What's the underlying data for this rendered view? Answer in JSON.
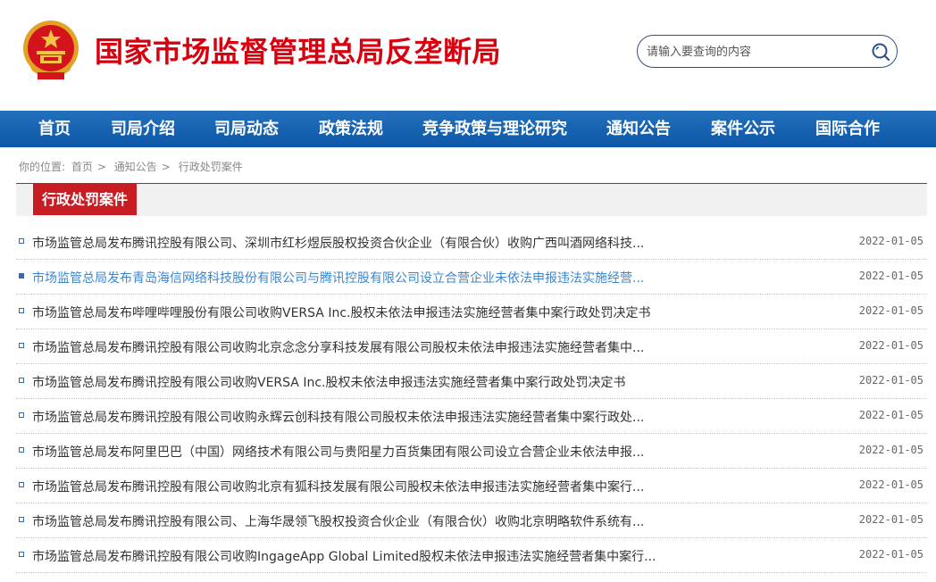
{
  "header": {
    "site_title": "国家市场监督管理总局反垄断局",
    "search_placeholder": "请输入要查询的内容"
  },
  "nav": {
    "items": [
      {
        "label": "首页"
      },
      {
        "label": "司局介绍"
      },
      {
        "label": "司局动态"
      },
      {
        "label": "政策法规"
      },
      {
        "label": "竞争政策与理论研究"
      },
      {
        "label": "通知公告"
      },
      {
        "label": "案件公示"
      },
      {
        "label": "国际合作"
      }
    ]
  },
  "breadcrumb": {
    "prefix": "你的位置:",
    "items": [
      "首页",
      "通知公告",
      "行政处罚案件"
    ],
    "separator": ">"
  },
  "section": {
    "title": "行政处罚案件"
  },
  "news": [
    {
      "title": "市场监管总局发布腾讯控股有限公司、深圳市红杉煜辰股权投资合伙企业（有限合伙）收购广西叫酒网络科技...",
      "date": "2022-01-05"
    },
    {
      "title": "市场监管总局发布青岛海信网络科技股份有限公司与腾讯控股有限公司设立合营企业未依法申报违法实施经营...",
      "date": "2022-01-05"
    },
    {
      "title": "市场监管总局发布哔哩哔哩股份有限公司收购VERSA Inc.股权未依法申报违法实施经营者集中案行政处罚决定书",
      "date": "2022-01-05"
    },
    {
      "title": "市场监管总局发布腾讯控股有限公司收购北京念念分享科技发展有限公司股权未依法申报违法实施经营者集中...",
      "date": "2022-01-05"
    },
    {
      "title": "市场监管总局发布腾讯控股有限公司收购VERSA Inc.股权未依法申报违法实施经营者集中案行政处罚决定书",
      "date": "2022-01-05"
    },
    {
      "title": "市场监管总局发布腾讯控股有限公司收购永辉云创科技有限公司股权未依法申报违法实施经营者集中案行政处...",
      "date": "2022-01-05"
    },
    {
      "title": "市场监管总局发布阿里巴巴（中国）网络技术有限公司与贵阳星力百货集团有限公司设立合营企业未依法申报...",
      "date": "2022-01-05"
    },
    {
      "title": "市场监管总局发布腾讯控股有限公司收购北京有狐科技发展有限公司股权未依法申报违法实施经营者集中案行...",
      "date": "2022-01-05"
    },
    {
      "title": "市场监管总局发布腾讯控股有限公司、上海华晟领飞股权投资合伙企业（有限合伙）收购北京明略软件系统有...",
      "date": "2022-01-05"
    },
    {
      "title": "市场监管总局发布腾讯控股有限公司收购IngageApp Global Limited股权未依法申报违法实施经营者集中案行...",
      "date": "2022-01-05"
    }
  ],
  "colors": {
    "brand_red": "#d7000f",
    "nav_blue": "#1160b1",
    "link_active": "#3d86cc"
  }
}
